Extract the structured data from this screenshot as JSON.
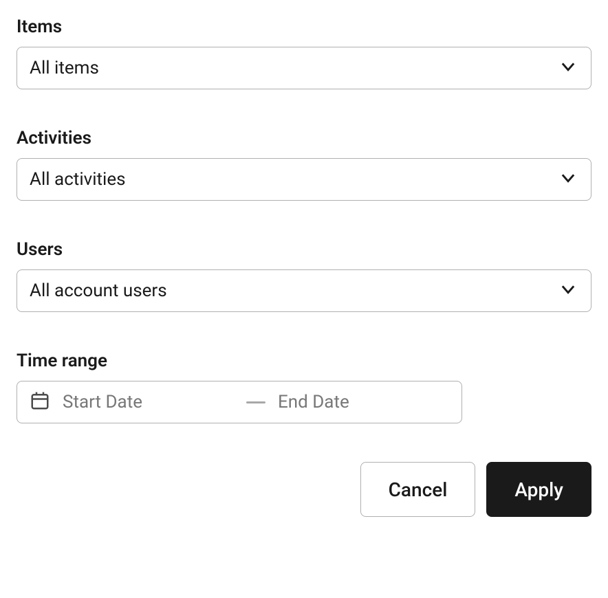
{
  "fields": {
    "items": {
      "label": "Items",
      "value": "All items"
    },
    "activities": {
      "label": "Activities",
      "value": "All activities"
    },
    "users": {
      "label": "Users",
      "value": "All account users"
    },
    "timerange": {
      "label": "Time range",
      "start_placeholder": "Start Date",
      "end_placeholder": "End Date"
    }
  },
  "buttons": {
    "cancel": "Cancel",
    "apply": "Apply"
  }
}
